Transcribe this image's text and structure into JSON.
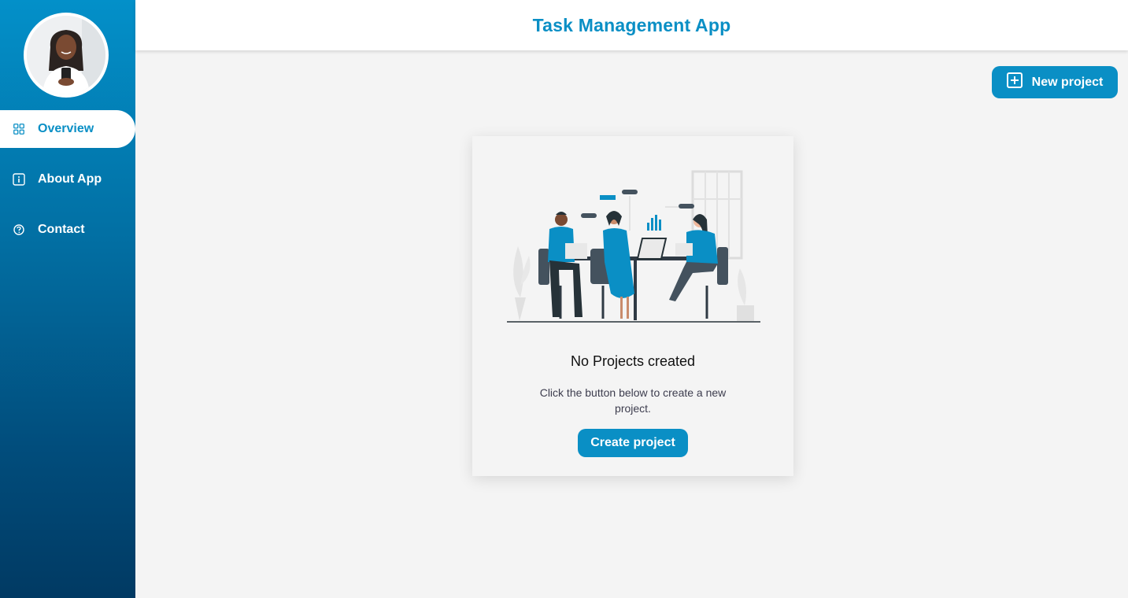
{
  "header": {
    "title": "Task Management App"
  },
  "sidebar": {
    "items": [
      {
        "label": "Overview",
        "icon": "grid-icon",
        "active": true
      },
      {
        "label": "About App",
        "icon": "info-icon",
        "active": false
      },
      {
        "label": "Contact",
        "icon": "help-circle-icon",
        "active": false
      }
    ]
  },
  "toolbar": {
    "new_project_label": "New project",
    "new_project_icon": "plus-square-icon"
  },
  "empty_state": {
    "title": "No Projects created",
    "description": "Click the button below to create a new project.",
    "button_label": "Create project",
    "illustration": "team-meeting-illustration"
  },
  "colors": {
    "accent": "#0a8fc5",
    "sidebar_top": "#0390c9",
    "sidebar_bottom": "#013a63",
    "background": "#f4f4f4"
  }
}
